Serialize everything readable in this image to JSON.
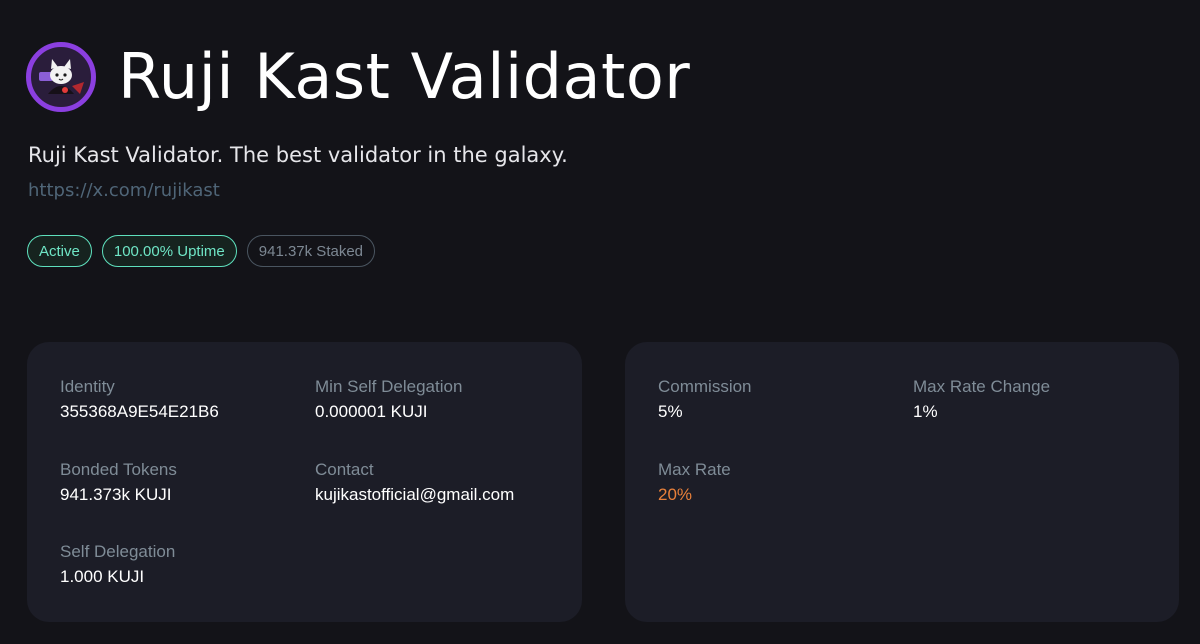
{
  "header": {
    "title": "Ruji Kast Validator",
    "description": "Ruji Kast Validator. The best validator in the galaxy.",
    "link": "https://x.com/rujikast"
  },
  "badges": {
    "active": "Active",
    "uptime": "100.00% Uptime",
    "staked": "941.37k Staked"
  },
  "details": {
    "identity_label": "Identity",
    "identity_value": "355368A9E54E21B6",
    "min_self_delegation_label": "Min Self Delegation",
    "min_self_delegation_value": "0.000001 KUJI",
    "bonded_tokens_label": "Bonded Tokens",
    "bonded_tokens_value": "941.373k KUJI",
    "contact_label": "Contact",
    "contact_value": "kujikastofficial@gmail.com",
    "self_delegation_label": "Self Delegation",
    "self_delegation_value": "1.000 KUJI"
  },
  "commission": {
    "commission_label": "Commission",
    "commission_value": "5%",
    "max_rate_change_label": "Max Rate Change",
    "max_rate_change_value": "1%",
    "max_rate_label": "Max Rate",
    "max_rate_value": "20%"
  },
  "colors": {
    "background": "#131318",
    "card": "#1c1d27",
    "accent_green": "#5ee0bd",
    "accent_orange": "#e9803a",
    "avatar_ring": "#8b3fe0"
  }
}
